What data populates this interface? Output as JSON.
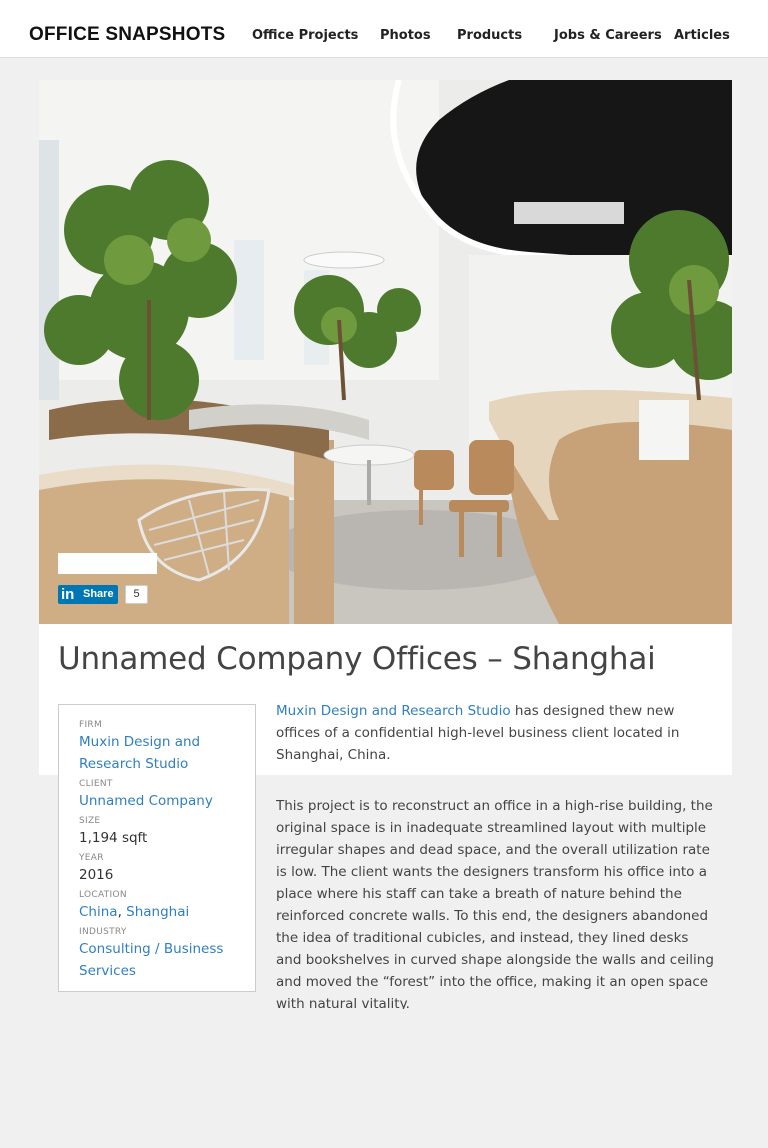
{
  "header": {
    "logo": "OFFICE SNAPSHOTS",
    "nav": [
      "Office Projects",
      "Photos",
      "Products",
      "Jobs & Careers",
      "Articles"
    ]
  },
  "share": {
    "network": "in",
    "label": "Share",
    "count": "5"
  },
  "article": {
    "title": "Unnamed Company Offices – Shanghai",
    "intro_link": "Muxin Design and Research Studio",
    "intro_rest": " has designed thew new offices of a confidential high-level business client located in Shanghai, China.",
    "body": "This project is to reconstruct an office in a high-rise building, the original space is in inadequate streamlined layout with multiple irregular shapes and dead space, and the overall utilization rate is low. The client wants the designers transform his office into a place where his staff can take a breath of nature behind the reinforced concrete walls. To this end, the designers abandoned the idea of traditional cubicles, and instead, they lined desks and bookshelves in curved shape alongside the walls and ceiling and moved the “forest” into the office, making it an open space with natural vitality."
  },
  "details": {
    "firm_label": "FIRM",
    "firm": "Muxin Design and Research Studio",
    "client_label": "CLIENT",
    "client": "Unnamed Company",
    "size_label": "SIZE",
    "size": "1,194 sqft",
    "year_label": "YEAR",
    "year": "2016",
    "location_label": "LOCATION",
    "location_country": "China",
    "location_sep": ", ",
    "location_city": "Shanghai",
    "industry_label": "INDUSTRY",
    "industry": "Consulting / Business Services"
  },
  "colors": {
    "link": "#2f7fc1",
    "linkedin": "#0077b5",
    "background": "#f0f0f0"
  }
}
